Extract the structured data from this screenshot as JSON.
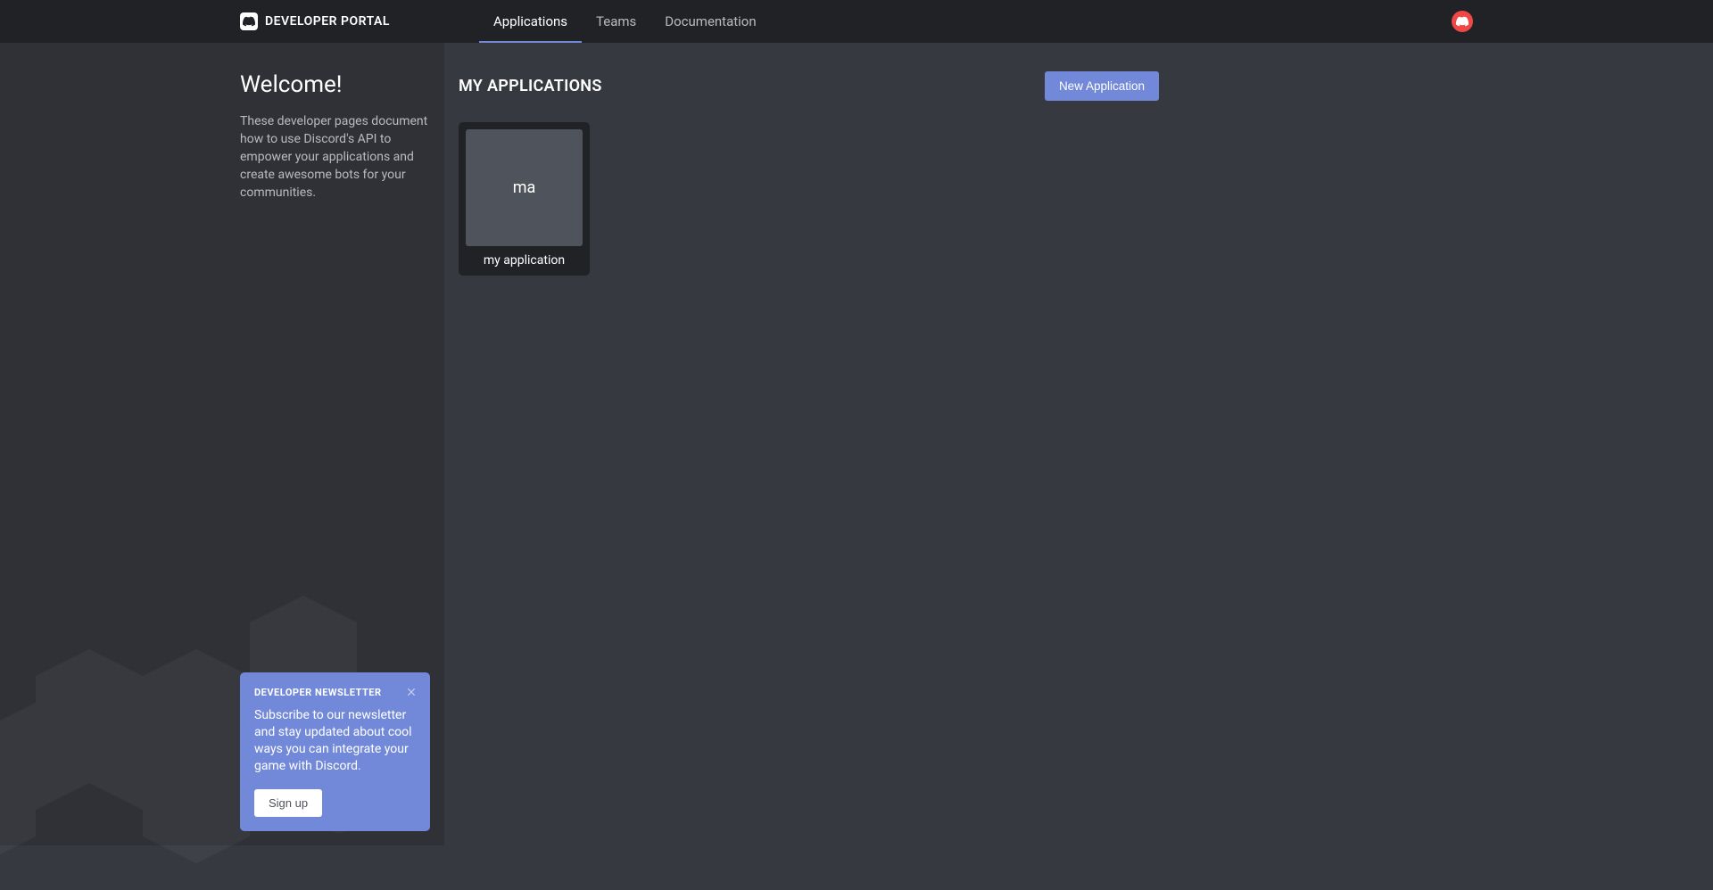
{
  "header": {
    "portal_title": "DEVELOPER PORTAL",
    "tabs": [
      {
        "label": "Applications",
        "active": true
      },
      {
        "label": "Teams",
        "active": false
      },
      {
        "label": "Documentation",
        "active": false
      }
    ]
  },
  "sidebar": {
    "welcome_title": "Welcome!",
    "welcome_text": "These developer pages document how to use Discord's API to empower your applications and create awesome bots for your communities."
  },
  "newsletter": {
    "title": "DEVELOPER NEWSLETTER",
    "body": "Subscribe to our newsletter and stay updated about cool ways you can integrate your game with Discord.",
    "button": "Sign up"
  },
  "main": {
    "title": "MY APPLICATIONS",
    "new_button": "New Application",
    "applications": [
      {
        "thumb_text": "ma",
        "name": "my application"
      }
    ]
  },
  "colors": {
    "accent": "#7289da",
    "bg_dark": "#202225",
    "bg_sidebar": "#2f3136",
    "bg_main": "#36393f",
    "avatar_bg": "#f04747"
  }
}
